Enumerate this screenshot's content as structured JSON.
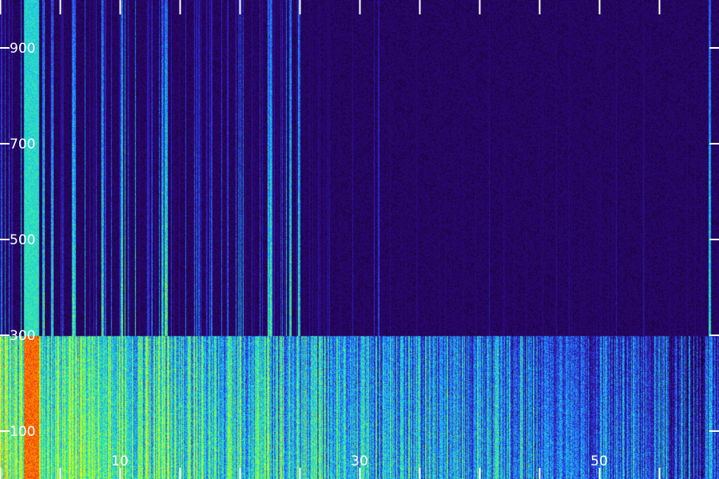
{
  "chart_data": {
    "type": "heatmap",
    "title": "",
    "xlabel": "",
    "ylabel": "",
    "xlim": [
      0,
      60
    ],
    "ylim": [
      0,
      1000
    ],
    "x_tick_labels": [
      {
        "value": 10,
        "label": "10"
      },
      {
        "value": 30,
        "label": "30"
      },
      {
        "value": 50,
        "label": "50"
      }
    ],
    "y_tick_labels": [
      {
        "value": 900,
        "label": "900"
      },
      {
        "value": 700,
        "label": "700"
      },
      {
        "value": 500,
        "label": "500"
      },
      {
        "value": 300,
        "label": "300"
      },
      {
        "value": 100,
        "label": "100"
      }
    ],
    "x_tick_values": [
      0,
      5,
      10,
      15,
      20,
      25,
      30,
      35,
      40,
      45,
      50,
      55
    ],
    "colormap": [
      "#1a0033",
      "#2a0a7a",
      "#2f2ad0",
      "#1e8cff",
      "#22e0d0",
      "#7dff3a",
      "#f0ff1a",
      "#ff8a00",
      "#e0101a"
    ],
    "background_color": "#1b0630",
    "tick_color": "#ffffff",
    "intensity_profile": {
      "cutoff_frequency": 300,
      "high_intensity_column": [
        2.0,
        3.2
      ],
      "description_levels": "low frequencies (< 300) show strong broadband energy; above 300 mostly low energy with scattered vertical streaks"
    }
  }
}
